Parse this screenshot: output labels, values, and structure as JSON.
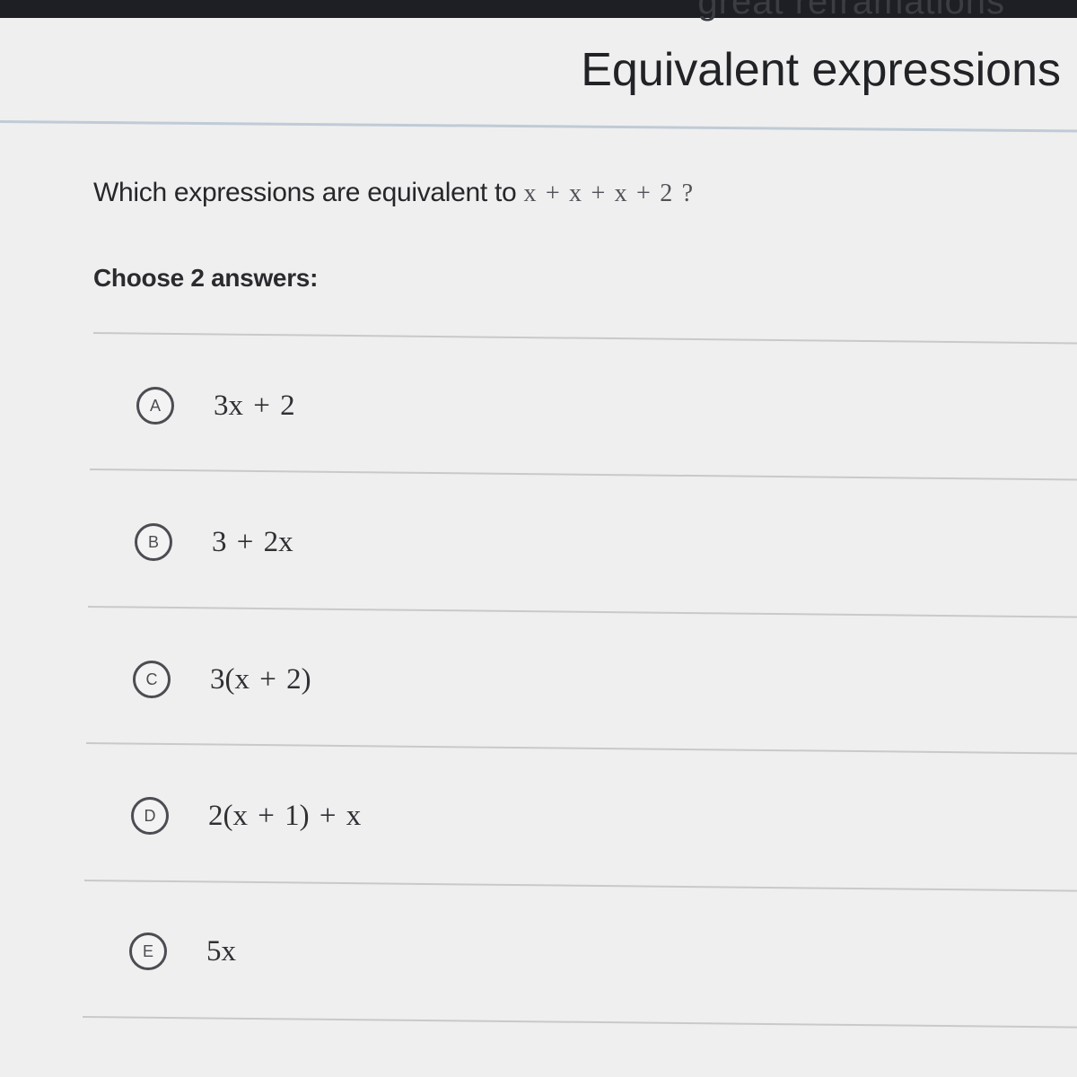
{
  "header": {
    "ghost_text": "great reframations",
    "title": "Equivalent expressions"
  },
  "question": {
    "prompt": "Which expressions are equivalent to",
    "expression": "x + x + x + 2 ?"
  },
  "instruction": "Choose 2 answers:",
  "choices": [
    {
      "letter": "A",
      "expression": "3x + 2"
    },
    {
      "letter": "B",
      "expression": "3 + 2x"
    },
    {
      "letter": "C",
      "expression": "3(x + 2)"
    },
    {
      "letter": "D",
      "expression": "2(x + 1) + x"
    },
    {
      "letter": "E",
      "expression": "5x"
    }
  ]
}
